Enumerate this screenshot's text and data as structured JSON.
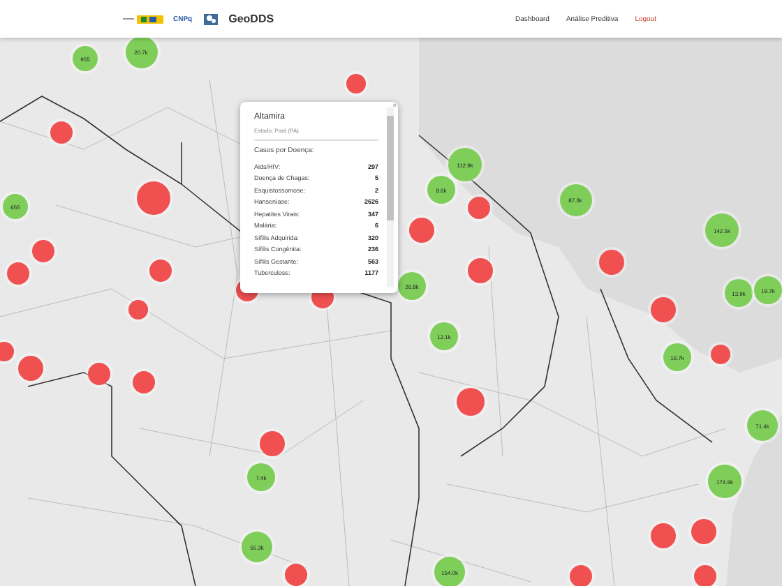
{
  "header": {
    "logo_text": "CNPq",
    "brand": "GeoDDS",
    "nav": [
      {
        "label": "Dashboard",
        "kind": "link"
      },
      {
        "label": "Análise Preditiva",
        "kind": "link"
      },
      {
        "label": "Logout",
        "kind": "logout"
      }
    ]
  },
  "map": {
    "markers": [
      {
        "label": "955",
        "color": "#7fce5a"
      },
      {
        "label": "20.7k",
        "color": "#7fce5a"
      },
      {
        "label": "655",
        "color": "#7fce5a"
      },
      {
        "label": "112.9k",
        "color": "#7fce5a"
      },
      {
        "label": "8.6k",
        "color": "#7fce5a"
      },
      {
        "label": "87.3k",
        "color": "#7fce5a"
      },
      {
        "label": "142.5k",
        "color": "#7fce5a"
      },
      {
        "label": "26.8k",
        "color": "#7fce5a"
      },
      {
        "label": "13.9k",
        "color": "#7fce5a"
      },
      {
        "label": "19.7k",
        "color": "#7fce5a"
      },
      {
        "label": "12.1k",
        "color": "#7fce5a"
      },
      {
        "label": "16.7k",
        "color": "#7fce5a"
      },
      {
        "label": "71.4k",
        "color": "#7fce5a"
      },
      {
        "label": "174.9k",
        "color": "#7fce5a"
      },
      {
        "label": "7.4k",
        "color": "#7fce5a"
      },
      {
        "label": "55.3k",
        "color": "#7fce5a"
      },
      {
        "label": "154.0k",
        "color": "#7fce5a"
      },
      {
        "color": "#f05050"
      },
      {
        "color": "#f05050"
      },
      {
        "color": "#f05050"
      },
      {
        "color": "#f05050"
      },
      {
        "color": "#f05050"
      },
      {
        "color": "#f05050"
      },
      {
        "color": "#f05050"
      },
      {
        "color": "#f05050"
      },
      {
        "color": "#f05050"
      },
      {
        "color": "#f05050"
      },
      {
        "color": "#f05050"
      },
      {
        "color": "#f05050"
      },
      {
        "color": "#f05050"
      },
      {
        "color": "#f05050"
      },
      {
        "color": "#f05050"
      },
      {
        "color": "#f05050"
      },
      {
        "color": "#f05050"
      },
      {
        "color": "#f05050"
      },
      {
        "color": "#f05050"
      },
      {
        "color": "#f05050"
      },
      {
        "color": "#f05050"
      },
      {
        "color": "#f05050"
      },
      {
        "color": "#f05050"
      },
      {
        "color": "#f05050"
      },
      {
        "color": "#f05050"
      },
      {
        "color": "#f05050"
      }
    ],
    "popup": {
      "close": "×",
      "title": "Altamira",
      "subtitle": "Estado: Pará (PA)",
      "heading": "Casos por Doença:",
      "rows": [
        {
          "name": "Aids/HIV:",
          "value": "297"
        },
        {
          "name": "Doença de Chagas:",
          "value": "5"
        },
        {
          "name": "Esquistossomose:",
          "value": "2"
        },
        {
          "name": "Hanseníase:",
          "value": "2626"
        },
        {
          "name": "Hepatites Virais:",
          "value": "347"
        },
        {
          "name": "Malária:",
          "value": "6"
        },
        {
          "name": "Sífilis Adquirida:",
          "value": "320"
        },
        {
          "name": "Sífilis Congênita:",
          "value": "236"
        },
        {
          "name": "Sífilis Gestante:",
          "value": "563"
        },
        {
          "name": "Tuberculose:",
          "value": "1177"
        }
      ]
    }
  }
}
